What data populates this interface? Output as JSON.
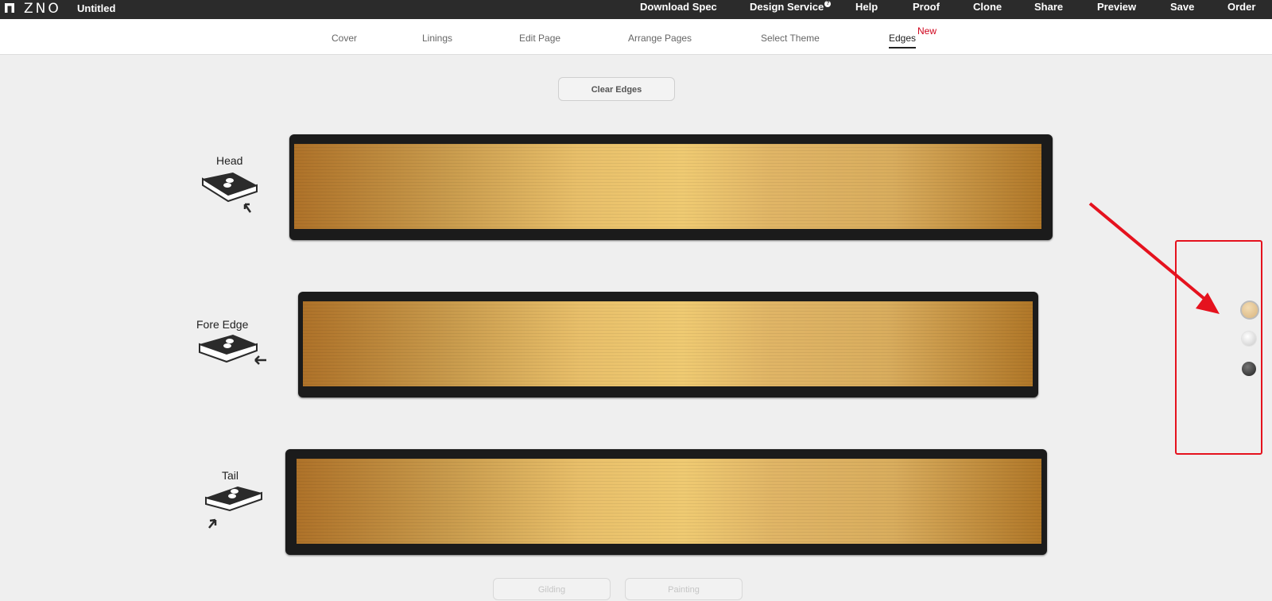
{
  "app": {
    "logo_text": "ZNO",
    "title": "Untitled"
  },
  "topbar": {
    "items": [
      {
        "label": "Download Spec"
      },
      {
        "label": "Design Service",
        "badge": "?"
      },
      {
        "label": "Help"
      },
      {
        "label": "Proof"
      },
      {
        "label": "Clone"
      },
      {
        "label": "Share"
      },
      {
        "label": "Preview"
      },
      {
        "label": "Save"
      },
      {
        "label": "Order"
      }
    ]
  },
  "tabs": {
    "items": [
      {
        "label": "Cover"
      },
      {
        "label": "Linings"
      },
      {
        "label": "Edit Page"
      },
      {
        "label": "Arrange Pages"
      },
      {
        "label": "Select Theme"
      },
      {
        "label": "Edges"
      }
    ],
    "active": "Edges",
    "new_badge": "New"
  },
  "toolbar": {
    "clear_label": "Clear Edges"
  },
  "edges": {
    "head_label": "Head",
    "fore_label": "Fore Edge",
    "tail_label": "Tail",
    "finish": "gold",
    "colors": {
      "cover": "#1b1b1b",
      "gold_light": "#efca72",
      "gold_dark": "#ae7229"
    }
  },
  "palette": {
    "swatches": [
      {
        "name": "gold",
        "color": "#e2c08f",
        "selected": true
      },
      {
        "name": "silver",
        "color": "#d6d6d6",
        "selected": false
      },
      {
        "name": "black",
        "color": "#2e2e2e",
        "selected": false
      }
    ],
    "highlight_color": "#e5121e"
  },
  "bottom": {
    "gilding_label": "Gilding",
    "painting_label": "Painting"
  }
}
